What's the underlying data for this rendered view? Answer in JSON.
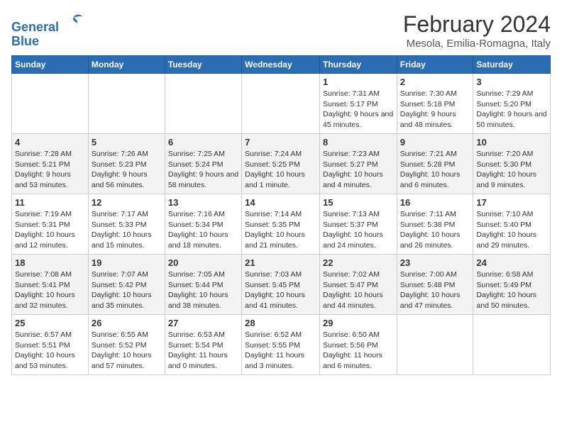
{
  "header": {
    "logo_line1": "General",
    "logo_line2": "Blue",
    "title": "February 2024",
    "subtitle": "Mesola, Emilia-Romagna, Italy"
  },
  "weekdays": [
    "Sunday",
    "Monday",
    "Tuesday",
    "Wednesday",
    "Thursday",
    "Friday",
    "Saturday"
  ],
  "weeks": [
    [
      {
        "day": "",
        "empty": true
      },
      {
        "day": "",
        "empty": true
      },
      {
        "day": "",
        "empty": true
      },
      {
        "day": "",
        "empty": true
      },
      {
        "day": "1",
        "sunrise": "7:31 AM",
        "sunset": "5:17 PM",
        "daylight": "9 hours and 45 minutes."
      },
      {
        "day": "2",
        "sunrise": "7:30 AM",
        "sunset": "5:18 PM",
        "daylight": "9 hours and 48 minutes."
      },
      {
        "day": "3",
        "sunrise": "7:29 AM",
        "sunset": "5:20 PM",
        "daylight": "9 hours and 50 minutes."
      }
    ],
    [
      {
        "day": "4",
        "sunrise": "7:28 AM",
        "sunset": "5:21 PM",
        "daylight": "9 hours and 53 minutes."
      },
      {
        "day": "5",
        "sunrise": "7:26 AM",
        "sunset": "5:23 PM",
        "daylight": "9 hours and 56 minutes."
      },
      {
        "day": "6",
        "sunrise": "7:25 AM",
        "sunset": "5:24 PM",
        "daylight": "9 hours and 58 minutes."
      },
      {
        "day": "7",
        "sunrise": "7:24 AM",
        "sunset": "5:25 PM",
        "daylight": "10 hours and 1 minute."
      },
      {
        "day": "8",
        "sunrise": "7:23 AM",
        "sunset": "5:27 PM",
        "daylight": "10 hours and 4 minutes."
      },
      {
        "day": "9",
        "sunrise": "7:21 AM",
        "sunset": "5:28 PM",
        "daylight": "10 hours and 6 minutes."
      },
      {
        "day": "10",
        "sunrise": "7:20 AM",
        "sunset": "5:30 PM",
        "daylight": "10 hours and 9 minutes."
      }
    ],
    [
      {
        "day": "11",
        "sunrise": "7:19 AM",
        "sunset": "5:31 PM",
        "daylight": "10 hours and 12 minutes."
      },
      {
        "day": "12",
        "sunrise": "7:17 AM",
        "sunset": "5:33 PM",
        "daylight": "10 hours and 15 minutes."
      },
      {
        "day": "13",
        "sunrise": "7:16 AM",
        "sunset": "5:34 PM",
        "daylight": "10 hours and 18 minutes."
      },
      {
        "day": "14",
        "sunrise": "7:14 AM",
        "sunset": "5:35 PM",
        "daylight": "10 hours and 21 minutes."
      },
      {
        "day": "15",
        "sunrise": "7:13 AM",
        "sunset": "5:37 PM",
        "daylight": "10 hours and 24 minutes."
      },
      {
        "day": "16",
        "sunrise": "7:11 AM",
        "sunset": "5:38 PM",
        "daylight": "10 hours and 26 minutes."
      },
      {
        "day": "17",
        "sunrise": "7:10 AM",
        "sunset": "5:40 PM",
        "daylight": "10 hours and 29 minutes."
      }
    ],
    [
      {
        "day": "18",
        "sunrise": "7:08 AM",
        "sunset": "5:41 PM",
        "daylight": "10 hours and 32 minutes."
      },
      {
        "day": "19",
        "sunrise": "7:07 AM",
        "sunset": "5:42 PM",
        "daylight": "10 hours and 35 minutes."
      },
      {
        "day": "20",
        "sunrise": "7:05 AM",
        "sunset": "5:44 PM",
        "daylight": "10 hours and 38 minutes."
      },
      {
        "day": "21",
        "sunrise": "7:03 AM",
        "sunset": "5:45 PM",
        "daylight": "10 hours and 41 minutes."
      },
      {
        "day": "22",
        "sunrise": "7:02 AM",
        "sunset": "5:47 PM",
        "daylight": "10 hours and 44 minutes."
      },
      {
        "day": "23",
        "sunrise": "7:00 AM",
        "sunset": "5:48 PM",
        "daylight": "10 hours and 47 minutes."
      },
      {
        "day": "24",
        "sunrise": "6:58 AM",
        "sunset": "5:49 PM",
        "daylight": "10 hours and 50 minutes."
      }
    ],
    [
      {
        "day": "25",
        "sunrise": "6:57 AM",
        "sunset": "5:51 PM",
        "daylight": "10 hours and 53 minutes."
      },
      {
        "day": "26",
        "sunrise": "6:55 AM",
        "sunset": "5:52 PM",
        "daylight": "10 hours and 57 minutes."
      },
      {
        "day": "27",
        "sunrise": "6:53 AM",
        "sunset": "5:54 PM",
        "daylight": "11 hours and 0 minutes."
      },
      {
        "day": "28",
        "sunrise": "6:52 AM",
        "sunset": "5:55 PM",
        "daylight": "11 hours and 3 minutes."
      },
      {
        "day": "29",
        "sunrise": "6:50 AM",
        "sunset": "5:56 PM",
        "daylight": "11 hours and 6 minutes."
      },
      {
        "day": "",
        "empty": true
      },
      {
        "day": "",
        "empty": true
      }
    ]
  ]
}
